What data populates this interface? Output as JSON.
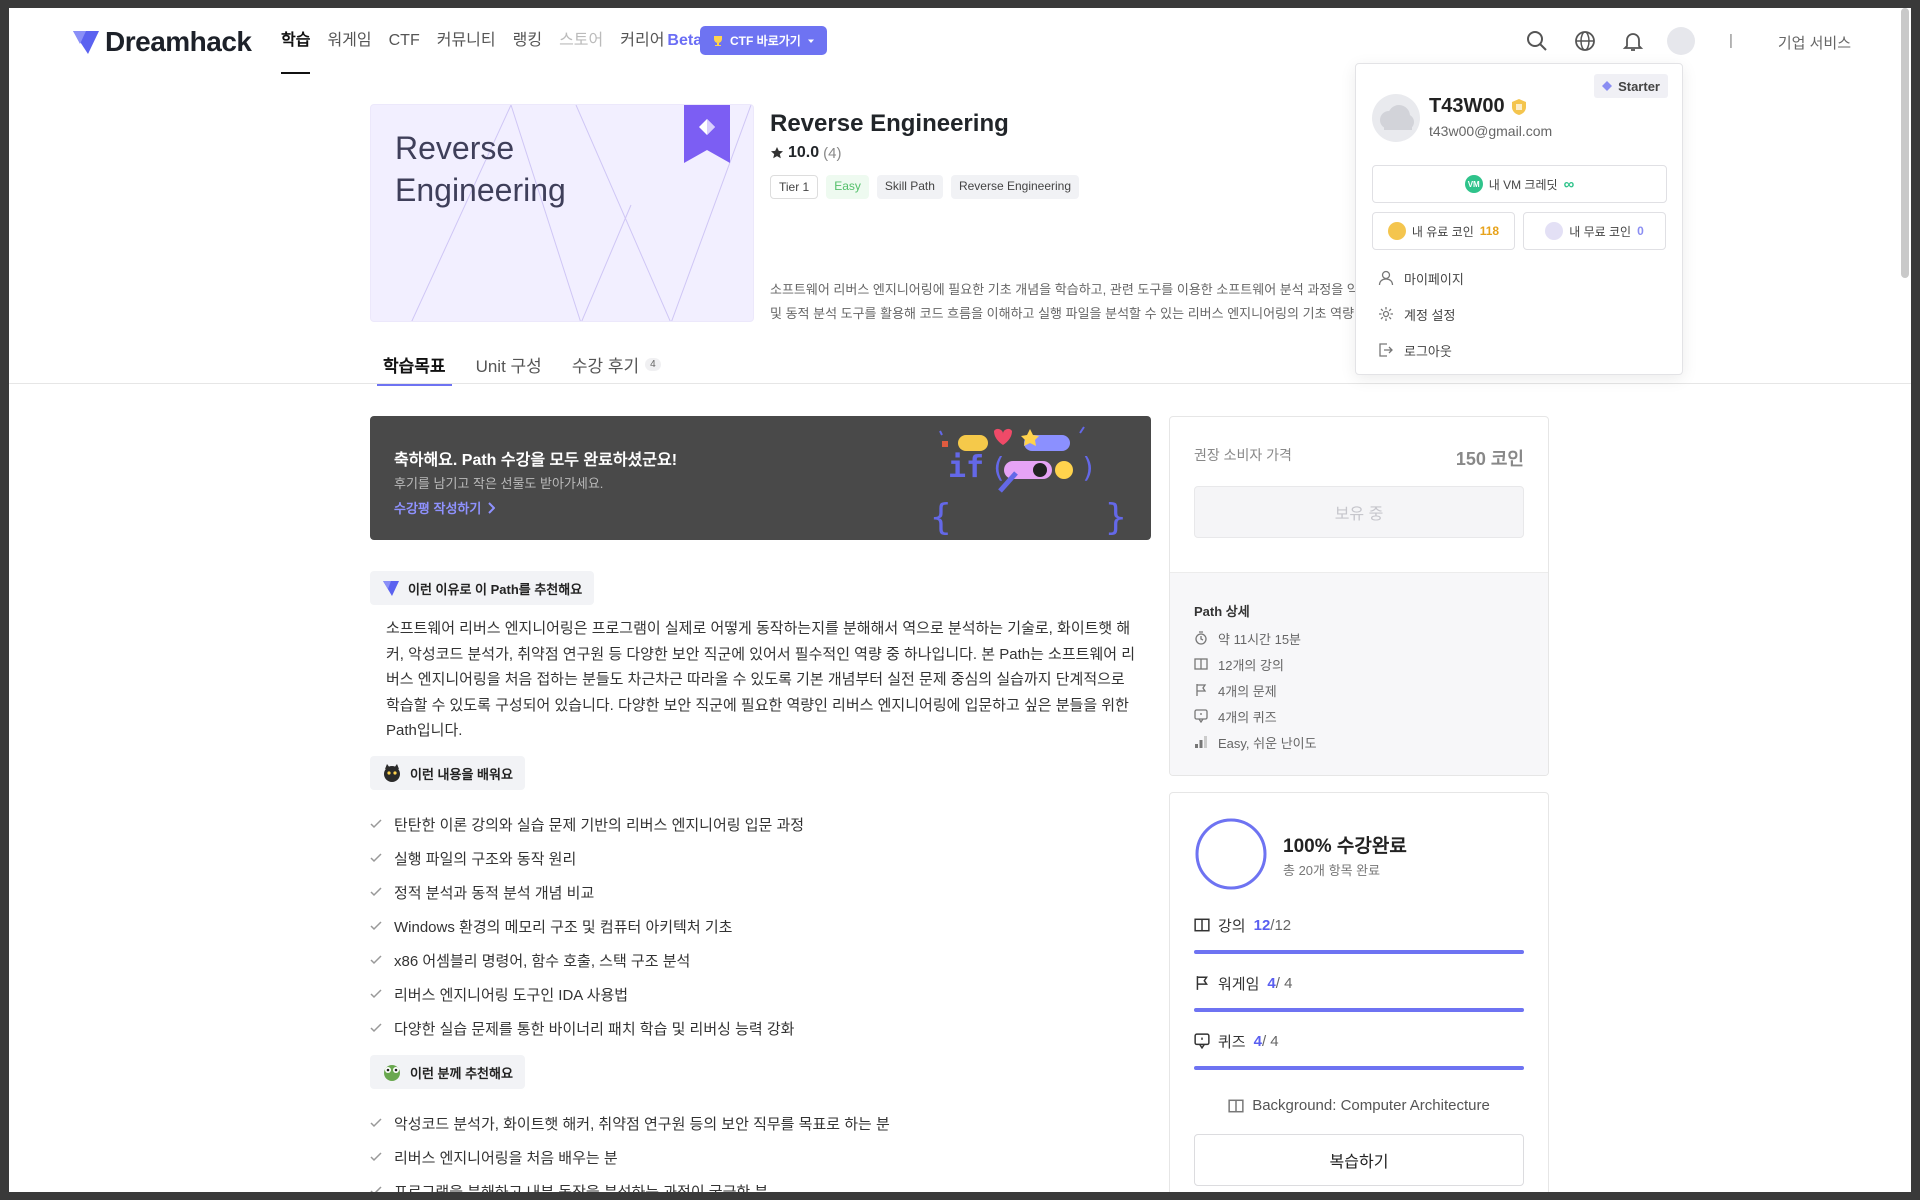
{
  "header": {
    "logo_text": "Dreamhack",
    "nav": [
      {
        "label": "학습",
        "active": true
      },
      {
        "label": "워게임"
      },
      {
        "label": "CTF"
      },
      {
        "label": "커뮤니티"
      },
      {
        "label": "랭킹"
      },
      {
        "label": "스토어",
        "muted": true
      },
      {
        "label": "커리어"
      }
    ],
    "career_beta": "Beta",
    "ctf_button": "CTF 바로가기",
    "divider_text": "|",
    "corp_service": "기업 서비스"
  },
  "hero": {
    "image_title_line1": "Reverse",
    "image_title_line2": "Engineering",
    "title": "Reverse Engineering",
    "rating": "10.0",
    "rating_count": "(4)",
    "tags": [
      "Tier 1",
      "Easy",
      "Skill Path",
      "Reverse Engineering"
    ],
    "desc_line1": "소프트웨어 리버스 엔지니어링에 필요한 기초 개념을 학습하고, 관련 도구를 이용한 소프트웨어 분석 과정을 익",
    "desc_line2": "및 동적 분석 도구를 활용해 코드 흐름을 이해하고 실행 파일을 분석할 수 있는 리버스 엔지니어링의 기초 역량"
  },
  "tabs": [
    {
      "label": "학습목표",
      "active": true
    },
    {
      "label": "Unit 구성"
    },
    {
      "label": "수강 후기",
      "badge": "4"
    }
  ],
  "banner": {
    "title": "축하해요. Path 수강을 모두 완료하셨군요!",
    "subtitle": "후기를 남기고 작은 선물도 받아가세요.",
    "link": "수강평 작성하기"
  },
  "sections": {
    "why_label": "이런 이유로 이 Path를 추천해요",
    "why_text": "소프트웨어 리버스 엔지니어링은 프로그램이 실제로 어떻게 동작하는지를 분해해서 역으로 분석하는 기술로, 화이트햇 해커, 악성코드 분석가, 취약점 연구원 등 다양한 보안 직군에 있어서 필수적인 역량 중 하나입니다. 본 Path는 소프트웨어 리버스 엔지니어링을 처음 접하는 분들도 차근차근 따라올 수 있도록 기본 개념부터 실전 문제 중심의 실습까지 단계적으로 학습할 수 있도록 구성되어 있습니다. 다양한 보안 직군에 필요한 역량인 리버스 엔지니어링에 입문하고 싶은 분들을 위한 Path입니다.",
    "learn_label": "이런 내용을 배워요",
    "learn_items": [
      "탄탄한 이론 강의와 실습 문제 기반의 리버스 엔지니어링 입문 과정",
      "실행 파일의 구조와 동작 원리",
      "정적 분석과 동적 분석 개념 비교",
      "Windows 환경의 메모리 구조 및 컴퓨터 아키텍처 기초",
      "x86 어셈블리 명령어, 함수 호출, 스택 구조 분석",
      "리버스 엔지니어링 도구인 IDA 사용법",
      "다양한 실습 문제를 통한 바이너리 패치 학습 및 리버싱 능력 강화"
    ],
    "target_label": "이런 분께 추천해요",
    "target_items": [
      "악성코드 분석가, 화이트햇 해커, 취약점 연구원 등의 보안 직무를 목표로 하는 분",
      "리버스 엔지니어링을 처음 배우는 분",
      "프로그램을 분해하고 내부 동작을 분석하는 과정이 궁금한 분"
    ]
  },
  "price_panel": {
    "label": "권장 소비자 가격",
    "value": "150 코인",
    "owned_button": "보유 중",
    "detail_title": "Path 상세",
    "details": [
      {
        "icon": "clock-icon",
        "text": "약 11시간 15분"
      },
      {
        "icon": "book-icon",
        "text": "12개의 강의"
      },
      {
        "icon": "flag-icon",
        "text": "4개의 문제"
      },
      {
        "icon": "quiz-icon",
        "text": "4개의 퀴즈"
      },
      {
        "icon": "level-icon",
        "text": "Easy, 쉬운 난이도"
      }
    ]
  },
  "progress": {
    "title": "100% 수강완료",
    "subtitle": "총 20개 항목 완료",
    "ring_fraction": 1.0,
    "rows": [
      {
        "icon": "book-icon",
        "label": "강의",
        "done": "12",
        "total": "/12",
        "fraction": 1.0
      },
      {
        "icon": "flag-icon",
        "label": "워게임",
        "done": "4",
        "total": "/ 4",
        "fraction": 1.0
      },
      {
        "icon": "quiz-icon",
        "label": "퀴즈",
        "done": "4",
        "total": "/ 4",
        "fraction": 1.0
      }
    ],
    "background": "Background: Computer Architecture",
    "review_button": "복습하기"
  },
  "dropdown": {
    "tier": "Starter",
    "username": "T43W00",
    "email": "t43w00@gmail.com",
    "vm_badge": "VM",
    "vm_label": "내 VM 크레딧",
    "vm_value": "∞",
    "paid_coin_label": "내 유료 코인",
    "paid_coin_value": "118",
    "free_coin_label": "내 무료 코인",
    "free_coin_value": "0",
    "menu": [
      {
        "icon": "user-icon",
        "label": "마이페이지"
      },
      {
        "icon": "gear-icon",
        "label": "계정 설정"
      },
      {
        "icon": "logout-icon",
        "label": "로그아웃"
      }
    ]
  },
  "colors": {
    "accent": "#6e73f2",
    "easy": "#54c06b",
    "vm": "#2fc38b",
    "coin": "#e7a21a"
  }
}
